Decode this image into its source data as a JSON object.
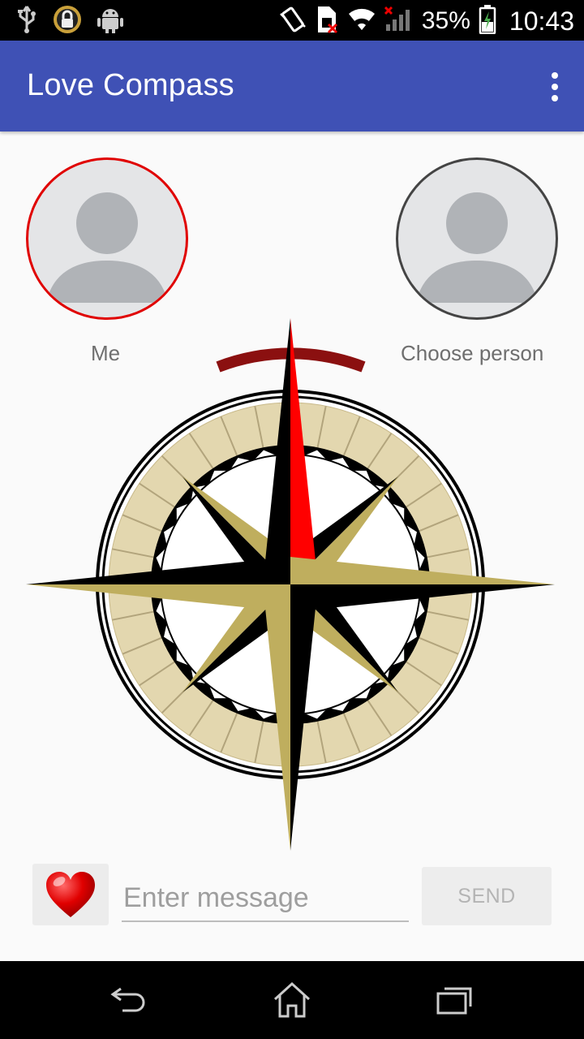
{
  "status_bar": {
    "battery_percent": "35%",
    "time": "10:43",
    "icons": [
      "usb-icon",
      "lock-icon",
      "android-debug-icon",
      "vibrate-icon",
      "sim-no-service-icon",
      "wifi-icon",
      "signal-no-data-icon",
      "battery-charging-icon"
    ]
  },
  "app_bar": {
    "title": "Love Compass",
    "overflow_icon": "more-vert-icon"
  },
  "avatars": {
    "me": {
      "label": "Me",
      "ring_color": "#e00000"
    },
    "other": {
      "label": "Choose person",
      "ring_color": "#444444"
    }
  },
  "compass": {
    "icon": "compass-rose-icon",
    "indicator_color": "#8b1010",
    "north_color": "#ff0000"
  },
  "message_bar": {
    "heart_icon": "heart-icon",
    "input_placeholder": "Enter message",
    "input_value": "",
    "send_label": "SEND"
  },
  "nav_bar": {
    "back_icon": "back-icon",
    "home_icon": "home-icon",
    "recents_icon": "recents-icon"
  },
  "colors": {
    "primary": "#3f51b5",
    "background": "#fafafa"
  }
}
